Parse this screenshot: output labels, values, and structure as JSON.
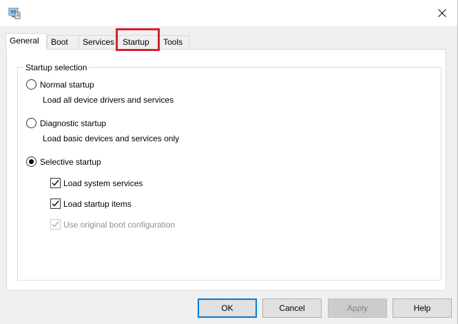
{
  "window": {
    "title": "",
    "close_icon": "close-icon",
    "app_icon": "msconfig-icon"
  },
  "tabs": [
    {
      "label": "General",
      "active": true
    },
    {
      "label": "Boot",
      "active": false
    },
    {
      "label": "Services",
      "active": false
    },
    {
      "label": "Startup",
      "active": false,
      "highlighted": true
    },
    {
      "label": "Tools",
      "active": false
    }
  ],
  "highlight_color": "#d0202e",
  "startup_selection": {
    "legend": "Startup selection",
    "options": [
      {
        "label": "Normal startup",
        "description": "Load all device drivers and services",
        "checked": false
      },
      {
        "label": "Diagnostic startup",
        "description": "Load basic devices and services only",
        "checked": false
      },
      {
        "label": "Selective startup",
        "checked": true
      }
    ],
    "selective_items": [
      {
        "label": "Load system services",
        "checked": true,
        "enabled": true
      },
      {
        "label": "Load startup items",
        "checked": true,
        "enabled": true
      },
      {
        "label": "Use original boot configuration",
        "checked": true,
        "enabled": false
      }
    ]
  },
  "buttons": {
    "ok": "OK",
    "cancel": "Cancel",
    "apply": "Apply",
    "help": "Help"
  },
  "colors": {
    "default_button_border": "#0078d7",
    "disabled_text": "#8f8f8f"
  }
}
